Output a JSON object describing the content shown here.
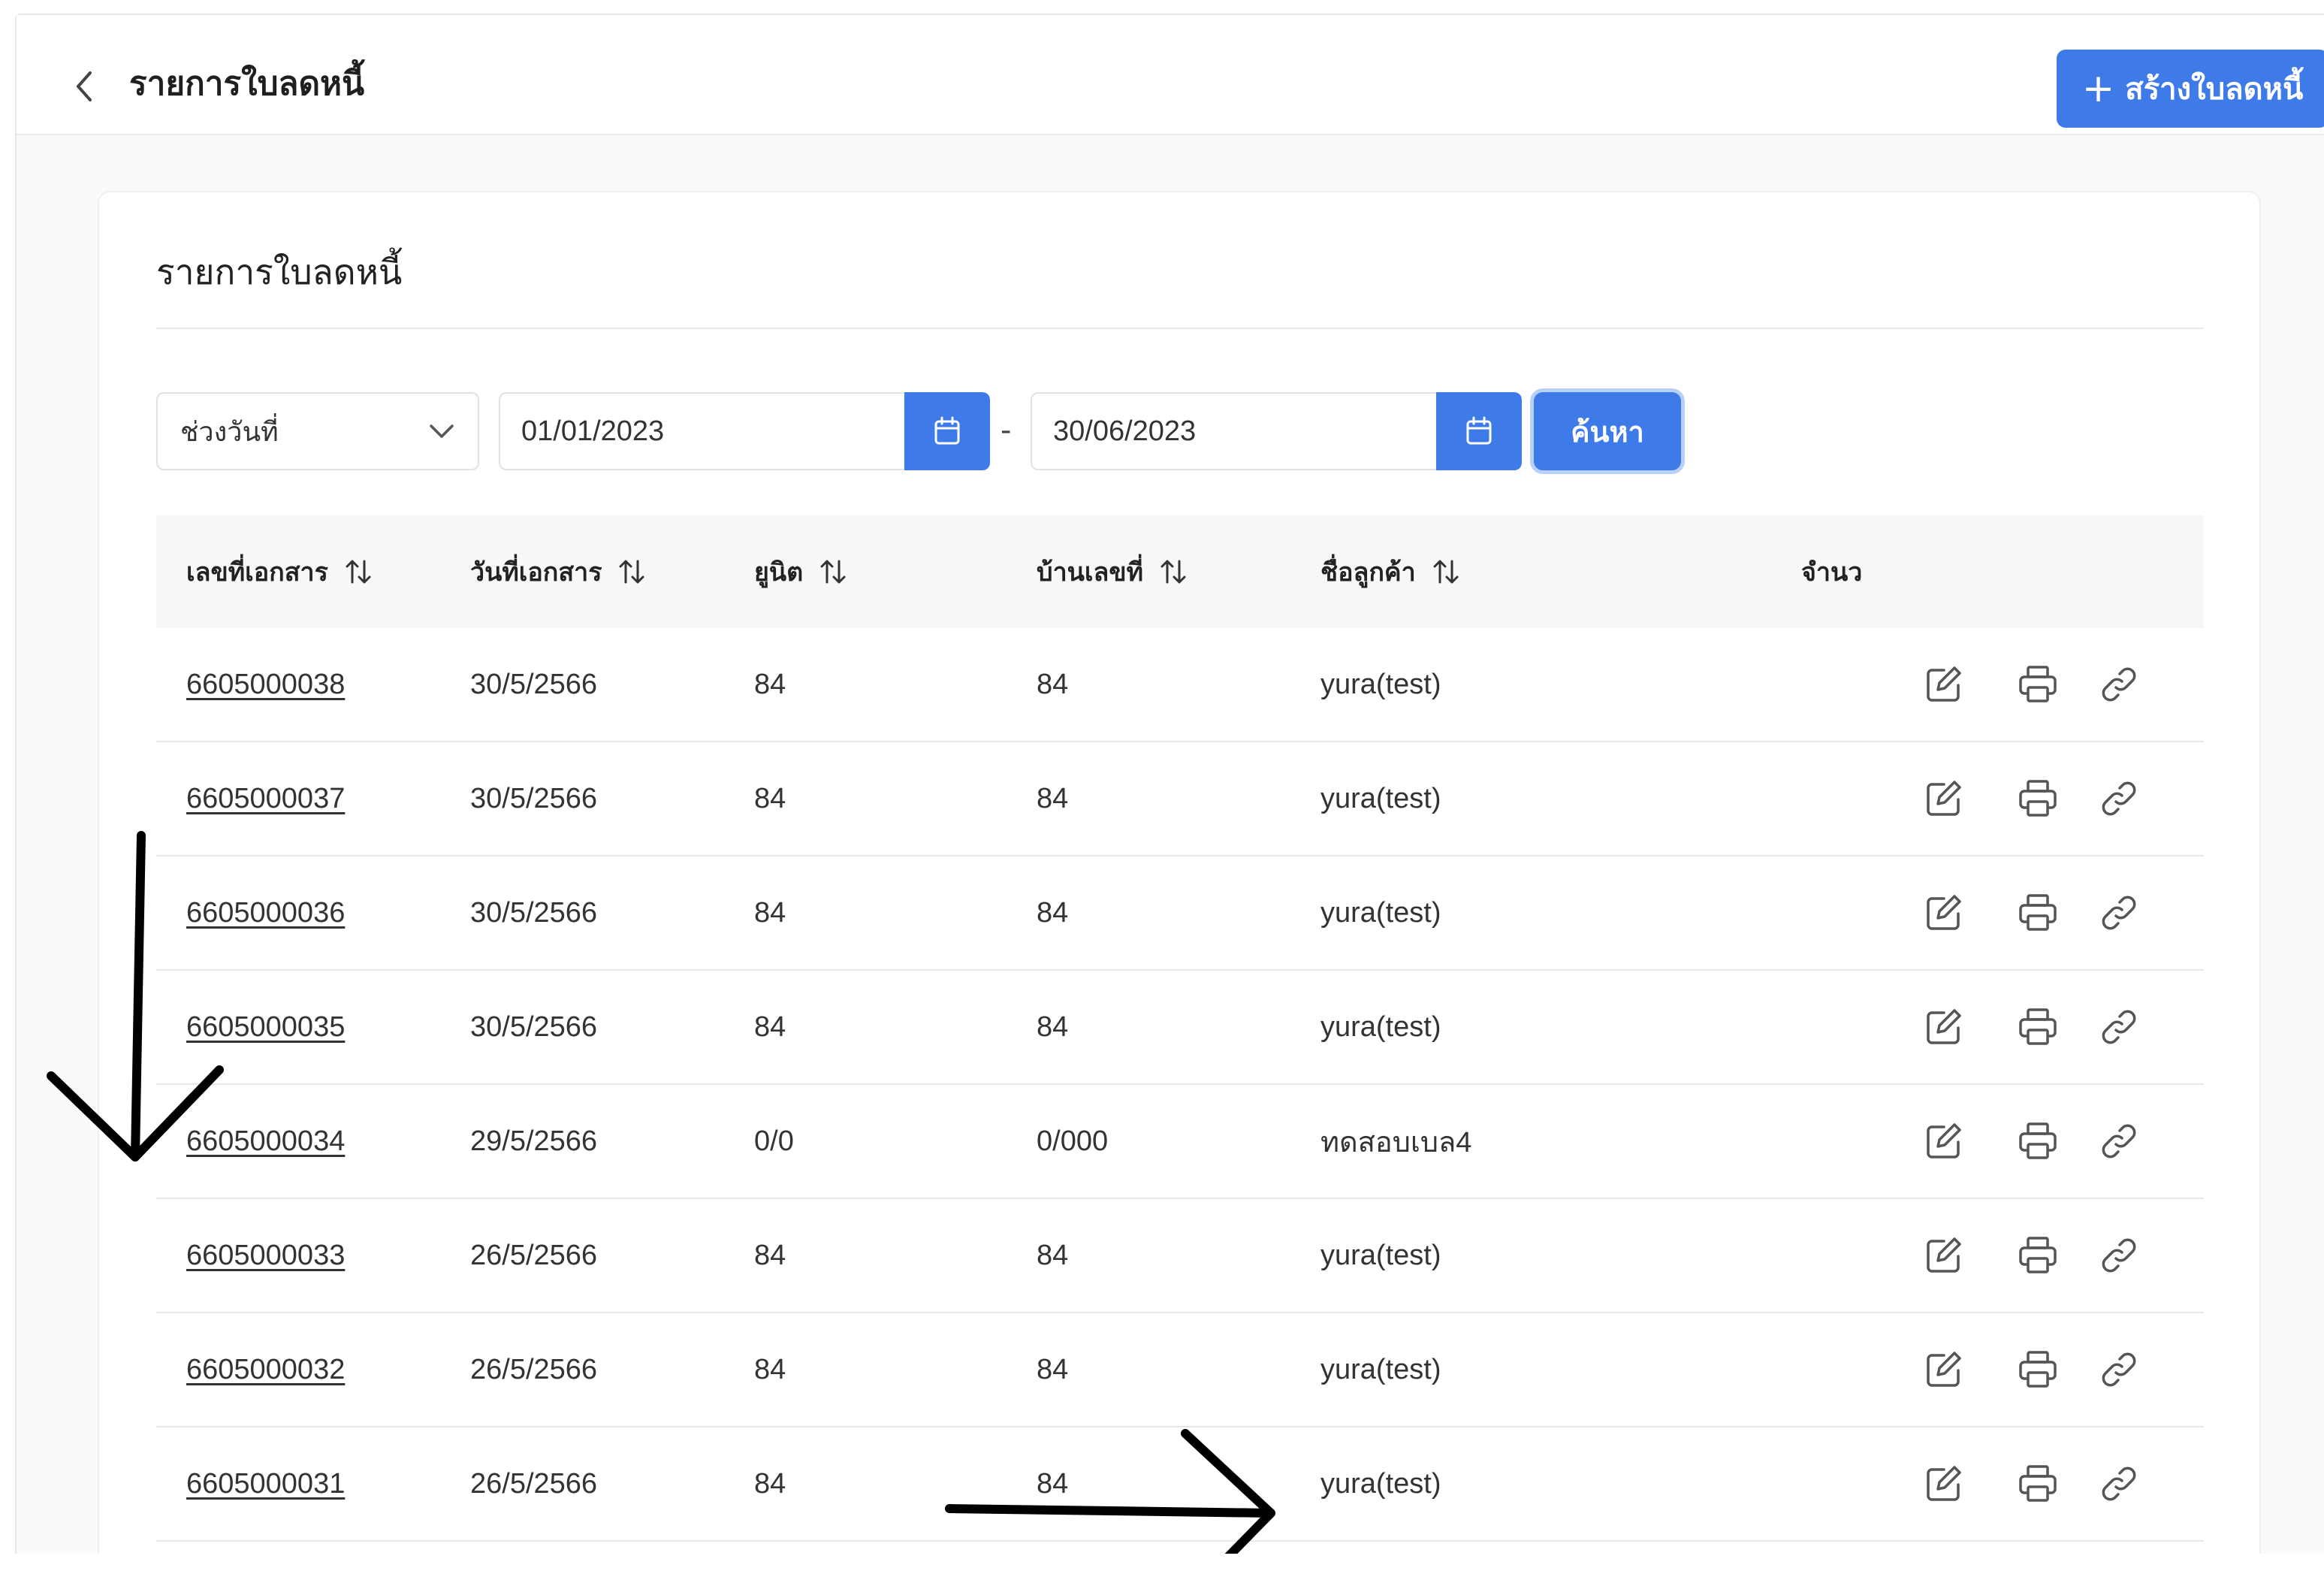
{
  "header": {
    "back_icon": "chevron-left-icon",
    "title": "รายการใบลดหนี้",
    "create_button_label": "สร้างใบลดหนี้",
    "create_button_icon": "plus-icon"
  },
  "card": {
    "title": "รายการใบลดหนี้"
  },
  "filters": {
    "range_select_value": "ช่วงวันที่",
    "start_date": "01/01/2023",
    "end_date": "30/06/2023",
    "separator": "-",
    "search_button_label": "ค้นหา"
  },
  "table": {
    "columns": [
      "เลขที่เอกสาร",
      "วันที่เอกสาร",
      "ยูนิต",
      "บ้านเลขที่",
      "ชื่อลูกค้า",
      "จำนว"
    ],
    "rows": [
      {
        "doc_no": "6605000038",
        "doc_date": "30/5/2566",
        "unit": "84",
        "house_no": "84",
        "customer": "yura(test)"
      },
      {
        "doc_no": "6605000037",
        "doc_date": "30/5/2566",
        "unit": "84",
        "house_no": "84",
        "customer": "yura(test)"
      },
      {
        "doc_no": "6605000036",
        "doc_date": "30/5/2566",
        "unit": "84",
        "house_no": "84",
        "customer": "yura(test)"
      },
      {
        "doc_no": "6605000035",
        "doc_date": "30/5/2566",
        "unit": "84",
        "house_no": "84",
        "customer": "yura(test)"
      },
      {
        "doc_no": "6605000034",
        "doc_date": "29/5/2566",
        "unit": "0/0",
        "house_no": "0/000",
        "customer": "ทดสอบเบล4"
      },
      {
        "doc_no": "6605000033",
        "doc_date": "26/5/2566",
        "unit": "84",
        "house_no": "84",
        "customer": "yura(test)"
      },
      {
        "doc_no": "6605000032",
        "doc_date": "26/5/2566",
        "unit": "84",
        "house_no": "84",
        "customer": "yura(test)"
      },
      {
        "doc_no": "6605000031",
        "doc_date": "26/5/2566",
        "unit": "84",
        "house_no": "84",
        "customer": "yura(test)"
      }
    ],
    "row_action_icons": [
      "edit-icon",
      "print-icon",
      "link-icon"
    ]
  },
  "colors": {
    "primary": "#3f7be8",
    "focus_ring": "#b9d0fb",
    "header_bg": "#f7f7f8",
    "annotation": "#000000"
  }
}
